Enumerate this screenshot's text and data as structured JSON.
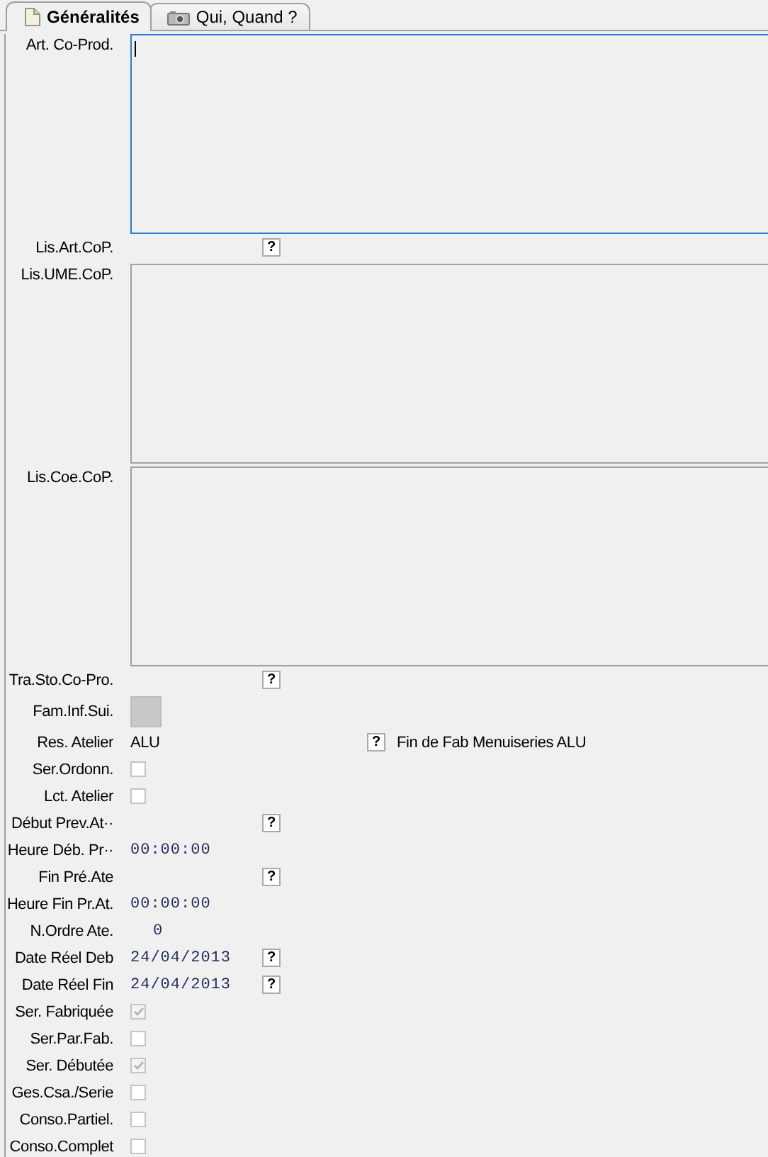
{
  "tabs": [
    {
      "label": "Généralités",
      "selected": true
    },
    {
      "label": "Qui, Quand ?",
      "selected": false
    }
  ],
  "fields": [
    {
      "kind": "memo",
      "label": "Art. Co-Prod.",
      "focused": true
    },
    {
      "kind": "help",
      "label": "Lis.Art.CoP.",
      "help": "?"
    },
    {
      "kind": "memo",
      "label": "Lis.UME.CoP.",
      "focused": false
    },
    {
      "kind": "memo",
      "label": "Lis.Coe.CoP.",
      "focused": false
    },
    {
      "kind": "help",
      "label": "Tra.Sto.Co-Pro.",
      "help": "?"
    },
    {
      "kind": "swatch",
      "label": "Fam.Inf.Sui."
    },
    {
      "kind": "text",
      "label": "Res. Atelier",
      "value": "ALU",
      "help": "?",
      "note": "Fin de Fab Menuiseries ALU"
    },
    {
      "kind": "check",
      "label": "Ser.Ordonn.",
      "checked": false
    },
    {
      "kind": "check",
      "label": "Lct. Atelier",
      "checked": false
    },
    {
      "kind": "help",
      "label": "Début Prev.At··",
      "help": "?"
    },
    {
      "kind": "mono",
      "label": "Heure Déb. Pr··",
      "value": "00:00:00"
    },
    {
      "kind": "help",
      "label": "Fin Pré.Ate",
      "help": "?"
    },
    {
      "kind": "mono",
      "label": "Heure Fin Pr.At.",
      "value": "00:00:00"
    },
    {
      "kind": "number",
      "label": "N.Ordre Ate.",
      "value": "0"
    },
    {
      "kind": "mono",
      "label": "Date Réel Deb",
      "value": "24/04/2013",
      "help": "?"
    },
    {
      "kind": "mono",
      "label": "Date Réel Fin",
      "value": "24/04/2013",
      "help": "?"
    },
    {
      "kind": "check",
      "label": "Ser. Fabriquée",
      "checked": true
    },
    {
      "kind": "check",
      "label": "Ser.Par.Fab.",
      "checked": false
    },
    {
      "kind": "check",
      "label": "Ser. Débutée",
      "checked": true
    },
    {
      "kind": "check",
      "label": "Ges.Csa./Serie",
      "checked": false
    },
    {
      "kind": "check",
      "label": "Conso.Partiel.",
      "checked": false
    },
    {
      "kind": "check",
      "label": "Conso.Complet",
      "checked": false
    }
  ]
}
